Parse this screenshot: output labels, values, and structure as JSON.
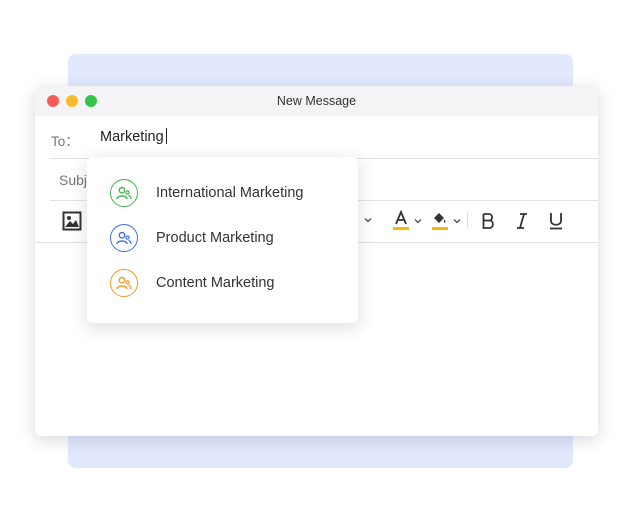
{
  "window": {
    "title": "New Message"
  },
  "to": {
    "label": "To：",
    "value": "Marketing"
  },
  "subject": {
    "label": "Subj"
  },
  "toolbar": {
    "icons": [
      "image-icon",
      "chevron-down-icon",
      "font-color-icon",
      "highlight-color-icon",
      "bold-icon",
      "italic-icon",
      "underline-icon"
    ],
    "font_color_accent": "#f5b900",
    "highlight_accent": "#f5b900"
  },
  "suggestions": [
    {
      "label": "International Marketing",
      "color": "#3fb54e",
      "icon": "group-icon"
    },
    {
      "label": "Product Marketing",
      "color": "#3d73db",
      "icon": "group-icon"
    },
    {
      "label": "Content Marketing",
      "color": "#ee9a2a",
      "icon": "group-icon"
    }
  ]
}
